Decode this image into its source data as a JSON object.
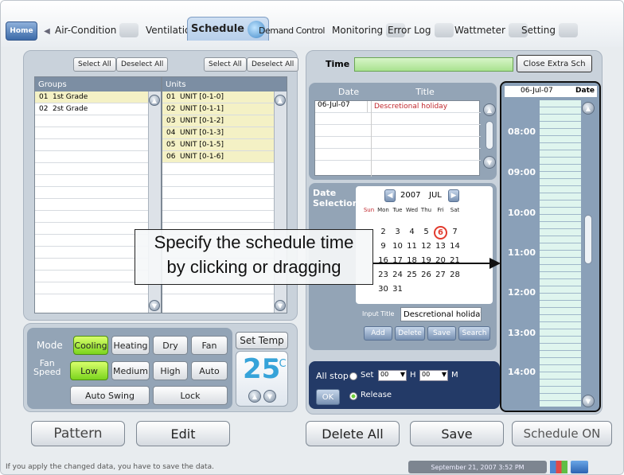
{
  "nav": {
    "home": "Home",
    "tabs": [
      "Air-Condition",
      "Ventilation",
      "Schedule",
      "Demand Control",
      "Monitoring",
      "Error Log",
      "Wattmeter",
      "Setting"
    ]
  },
  "left": {
    "select_all": "Select All",
    "deselect_all": "Deselect All",
    "groups_header": "Groups",
    "units_header": "Units",
    "groups": [
      {
        "id": "01",
        "name": "1st Grade"
      },
      {
        "id": "02",
        "name": "2st Grade"
      }
    ],
    "units": [
      {
        "id": "01",
        "name": "UNIT [0-1-0]"
      },
      {
        "id": "02",
        "name": "UNIT [0-1-1]"
      },
      {
        "id": "03",
        "name": "UNIT [0-1-2]"
      },
      {
        "id": "04",
        "name": "UNIT [0-1-3]"
      },
      {
        "id": "05",
        "name": "UNIT [0-1-5]"
      },
      {
        "id": "06",
        "name": "UNIT [0-1-6]"
      }
    ]
  },
  "mode": {
    "mode_label": "Mode",
    "modes": [
      "Cooling",
      "Heating",
      "Dry",
      "Fan"
    ],
    "fan_label_1": "Fan",
    "fan_label_2": "Speed",
    "fan_speeds": [
      "Low",
      "Medium",
      "High",
      "Auto"
    ],
    "auto_swing": "Auto Swing",
    "lock": "Lock",
    "set_temp_label": "Set Temp",
    "set_temp": "25",
    "temp_unit": "°C"
  },
  "right": {
    "time_label": "Time",
    "close_extra": "Close Extra Sch",
    "date_header": "Date",
    "title_header": "Title",
    "entries": [
      {
        "date": "06-Jul-07",
        "title": "Descretional holiday"
      }
    ],
    "date_selection_1": "Date",
    "date_selection_2": "Selection",
    "cal_year": "2007",
    "cal_month": "JUL",
    "weekdays": [
      "Sun",
      "Mon",
      "Tue",
      "Wed",
      "Thu",
      "Fri",
      "Sat"
    ],
    "cal_rows": [
      [
        "",
        "2",
        "3",
        "4",
        "5",
        "6",
        "7"
      ],
      [
        "",
        "9",
        "10",
        "11",
        "12",
        "13",
        "14"
      ],
      [
        "",
        "16",
        "17",
        "18",
        "19",
        "20",
        "21"
      ],
      [
        "",
        "23",
        "24",
        "25",
        "26",
        "27",
        "28"
      ],
      [
        "",
        "30",
        "31",
        "",
        "",
        "",
        ""
      ]
    ],
    "input_title_label": "Input Title",
    "input_title_value": "Descretional holiday",
    "add": "Add",
    "delete": "Delete",
    "save": "Save",
    "search": "Search",
    "all_stop": "All stop",
    "ok": "OK",
    "set": "Set",
    "hour_value": "00",
    "h_label": "H",
    "minute_value": "00",
    "m_label": "M",
    "release": "Release"
  },
  "schedule": {
    "date_value": "06-Jul-07",
    "date_label": "Date",
    "times": [
      "08:00",
      "09:00",
      "10:00",
      "11:00",
      "12:00",
      "13:00",
      "14:00"
    ]
  },
  "callout": {
    "line1": "Specify the schedule time",
    "line2": "by clicking or dragging"
  },
  "bottom": {
    "pattern": "Pattern",
    "edit": "Edit",
    "delete_all": "Delete All",
    "save": "Save",
    "schedule_on": "Schedule ON"
  },
  "status": {
    "message": "If you apply the changed data,  you have to save the data.",
    "datetime": "September 21, 2007 3:52 PM"
  }
}
